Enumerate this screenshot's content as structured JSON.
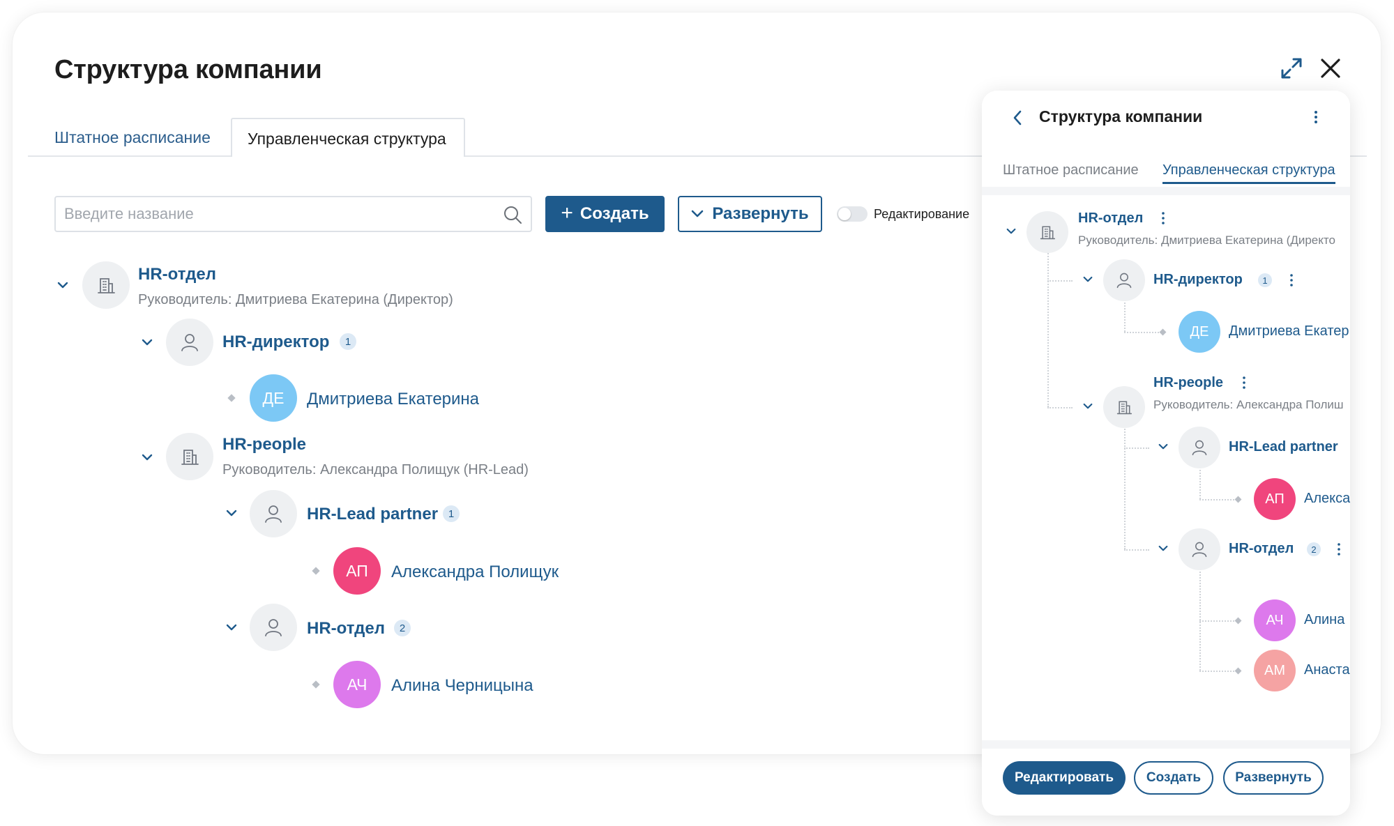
{
  "window": {
    "title": "Структура компании"
  },
  "tabs": [
    "Штатное расписание",
    "Управленческая структура"
  ],
  "toolbar": {
    "search_placeholder": "Введите название",
    "create_label": "Создать",
    "expand_label": "Развернуть",
    "edit_toggle_label": "Редактирование"
  },
  "tree": {
    "dept": {
      "name": "HR-отдел",
      "sub": "Руководитель: Дмитриева Екатерина (Директор)"
    },
    "director": {
      "name": "HR-директор",
      "count": "1"
    },
    "director_person": {
      "initials": "ДЕ",
      "name": "Дмитриева Екатерина"
    },
    "people": {
      "name": "HR-people",
      "sub": "Руководитель: Александра Полищук (HR-Lead)"
    },
    "lead": {
      "name": "HR-Lead partner",
      "count": "1"
    },
    "lead_person": {
      "initials": "АП",
      "name": "Александра Полищук"
    },
    "otdel": {
      "name": "HR-отдел",
      "count": "2"
    },
    "otdel_person": {
      "initials": "АЧ",
      "name": "Алина Черницына"
    }
  },
  "panel": {
    "title": "Структура компании",
    "tabs": [
      "Штатное расписание",
      "Управленческая структура"
    ],
    "tree": {
      "dept_name": "HR-отдел",
      "dept_sub": "Руководитель: Дмитриева Екатерина (Директо",
      "director_name": "HR-директор",
      "director_count": "1",
      "p1_initials": "ДЕ",
      "p1_name": "Дмитриева Екатер",
      "people_name": "HR-people",
      "people_sub": "Руководитель: Александра Полиш",
      "lead_name": "HR-Lead partner",
      "p2_initials": "АП",
      "p2_name": "Алекса",
      "otdel_name": "HR-отдел",
      "otdel_count": "2",
      "p3_initials": "АЧ",
      "p3_name": "Алина",
      "p4_initials": "АМ",
      "p4_name": "Анаста"
    },
    "buttons": {
      "edit": "Редактировать",
      "create": "Создать",
      "expand": "Развернуть"
    }
  },
  "colors": {
    "accent": "#1e5a8c",
    "avatar_de": "#7cc8f5",
    "avatar_ap": "#f0457d",
    "avatar_ach": "#dd79ec",
    "avatar_am": "#f5a3a3"
  }
}
